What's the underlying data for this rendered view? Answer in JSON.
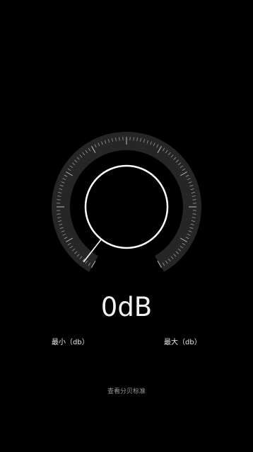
{
  "meter": {
    "value": 0,
    "reading": "0dB",
    "min_label": "最小（db）",
    "max_label": "最大（db）"
  },
  "footer": {
    "standard_link": "查看分贝标准"
  },
  "colors": {
    "background": "#000000",
    "dial_band": "#262626",
    "tick": "#bdbdbd",
    "needle": "#ffffff",
    "circle": "#ffffff"
  }
}
